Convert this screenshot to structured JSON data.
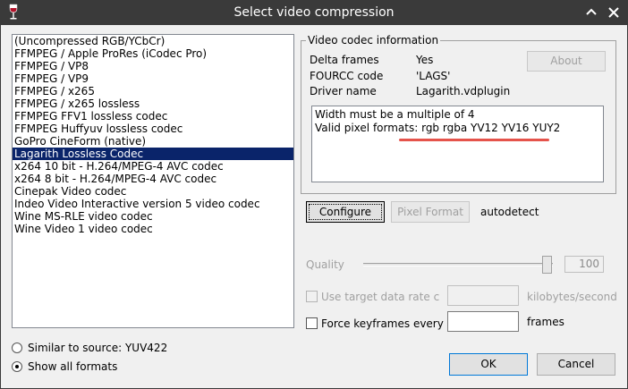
{
  "window": {
    "title": "Select video compression",
    "icons": {
      "app": "wine-glass-icon",
      "maximize": "caret-up-icon",
      "close": "close-icon"
    }
  },
  "codec_list": {
    "items": [
      "(Uncompressed RGB/YCbCr)",
      "FFMPEG / Apple ProRes (iCodec Pro)",
      "FFMPEG / VP8",
      "FFMPEG / VP9",
      "FFMPEG / x265",
      "FFMPEG / x265 lossless",
      "FFMPEG FFV1 lossless codec",
      "FFMPEG Huffyuv lossless codec",
      "GoPro CineForm (native)",
      "Lagarith Lossless Codec",
      "x264 10 bit - H.264/MPEG-4 AVC codec",
      "x264 8 bit - H.264/MPEG-4 AVC codec",
      "Cinepak Video codec",
      "Indeo Video Interactive version 5 video codec",
      "Wine MS-RLE video codec",
      "Wine Video 1 video codec"
    ],
    "selected_index": 9
  },
  "format_filter": {
    "similar_label": "Similar to source: YUV422",
    "all_label": "Show all formats",
    "selected": "all"
  },
  "codec_info": {
    "group_label": "Video codec information",
    "delta_label": "Delta frames",
    "delta_value": "Yes",
    "fourcc_label": "FOURCC code",
    "fourcc_value": "'LAGS'",
    "driver_label": "Driver name",
    "driver_value": "Lagarith.vdplugin",
    "about_label": "About",
    "notes": [
      "Width must be a multiple of 4",
      "Valid pixel formats: rgb rgba YV12 YV16 YUY2"
    ],
    "highlight_color": "#e5534b"
  },
  "actions": {
    "configure_label": "Configure",
    "pixel_format_label": "Pixel Format",
    "pixel_format_status": "autodetect"
  },
  "quality": {
    "label": "Quality",
    "value": "100",
    "slider_fraction": 1.0
  },
  "data_rate": {
    "label": "Use target data rate c",
    "unit": "kilobytes/second",
    "value": ""
  },
  "keyframes": {
    "label": "Force keyframes every",
    "unit": "frames",
    "value": ""
  },
  "dialog_buttons": {
    "ok_label": "OK",
    "cancel_label": "Cancel"
  }
}
